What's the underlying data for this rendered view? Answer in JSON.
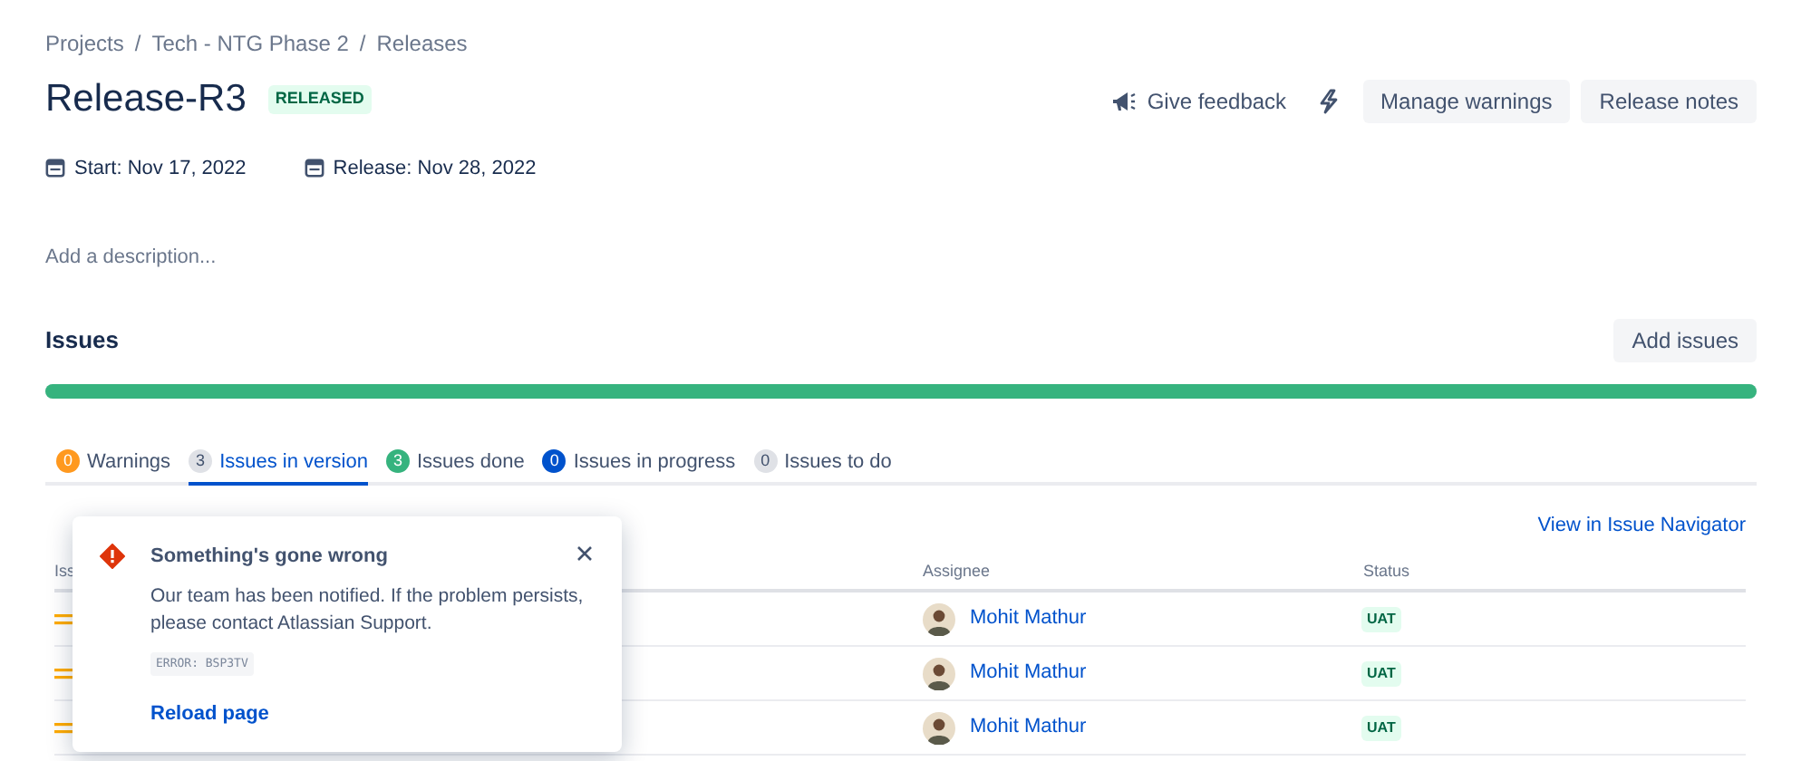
{
  "breadcrumbs": [
    "Projects",
    "Tech - NTG Phase 2",
    "Releases"
  ],
  "breadcrumb_separator": "/",
  "title": "Release-R3",
  "status_lozenge": "RELEASED",
  "header_actions": [
    {
      "kind": "link",
      "label": "Give feedback"
    },
    {
      "kind": "icon"
    },
    {
      "kind": "button",
      "label": "Manage warnings"
    },
    {
      "kind": "button",
      "label": "Release notes"
    }
  ],
  "dates": [
    "Start: Nov 17, 2022",
    "Release: Nov 28, 2022"
  ],
  "description_placeholder": "Add a description...",
  "issues": {
    "heading": "Issues",
    "add_button": "Add issues",
    "progress": {
      "level": 1
    },
    "tabs": [
      {
        "count": "0",
        "label": "Warnings",
        "color": "#ff991f",
        "selected": false
      },
      {
        "count": "3",
        "label": "Issues in version",
        "color": "#dfe1e6",
        "selected": true
      },
      {
        "count": "3",
        "label": "Issues done",
        "color": "#36b37e",
        "selected": false
      },
      {
        "count": "0",
        "label": "Issues in progress",
        "color": "#0052cc",
        "selected": false
      },
      {
        "count": "0",
        "label": "Issues to do",
        "color": "#dfe1e6",
        "selected": false
      }
    ],
    "navigator_link": "View in Issue Navigator",
    "table": {
      "columns": [
        "Iss",
        "Assignee",
        "Status"
      ],
      "rows": [
        {
          "assignee": "Mohit Mathur",
          "status": "UAT"
        },
        {
          "assignee": "Mohit Mathur",
          "status": "UAT"
        },
        {
          "assignee": "Mohit Mathur",
          "status": "UAT"
        }
      ]
    }
  },
  "error_flag": {
    "title": "Something's gone wrong",
    "message": "Our team has been notified. If the problem persists, please contact Atlassian Support.",
    "code": "ERROR: BSP3TV",
    "action": "Reload page"
  }
}
